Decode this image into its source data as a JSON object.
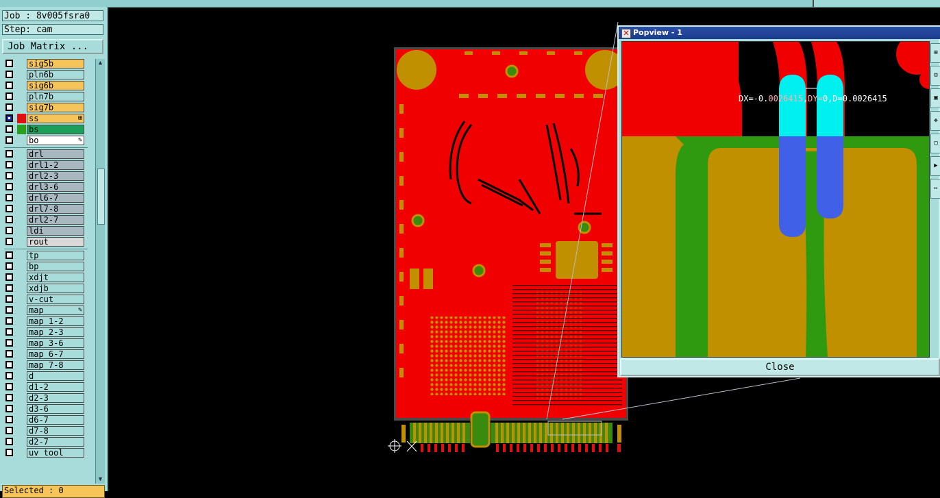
{
  "job": {
    "label": "Job : 8v005fsra0",
    "step": "Step: cam"
  },
  "buttons": {
    "job_matrix": "Job Matrix ...",
    "close": "Close"
  },
  "layers": [
    {
      "name": "sig5b",
      "color": "#f5c55a",
      "mark": ""
    },
    {
      "name": "pln6b",
      "color": "#a7dcda",
      "mark": ""
    },
    {
      "name": "sig6b",
      "color": "#f5c55a",
      "mark": ""
    },
    {
      "name": "pln7b",
      "color": "#a7dcda",
      "mark": ""
    },
    {
      "name": "sig7b",
      "color": "#f5c55a",
      "mark": ""
    },
    {
      "name": "ss",
      "color": "#f5c55a",
      "mark": "⊞",
      "checked": true,
      "swatch": "#e01010"
    },
    {
      "name": "bs",
      "color": "#1aa058",
      "mark": "",
      "swatch": "#2aa020"
    },
    {
      "name": "bo",
      "color": "#ffffff",
      "mark": "✎"
    },
    {
      "name": "drl",
      "color": "#a8b8c0",
      "mark": ""
    },
    {
      "name": "drl1-2",
      "color": "#a8b8c0",
      "mark": ""
    },
    {
      "name": "drl2-3",
      "color": "#a8b8c0",
      "mark": ""
    },
    {
      "name": "drl3-6",
      "color": "#a8b8c0",
      "mark": ""
    },
    {
      "name": "drl6-7",
      "color": "#a8b8c0",
      "mark": ""
    },
    {
      "name": "drl7-8",
      "color": "#a8b8c0",
      "mark": ""
    },
    {
      "name": "drl2-7",
      "color": "#a8b8c0",
      "mark": ""
    },
    {
      "name": "ldi",
      "color": "#a8b8c0",
      "mark": ""
    },
    {
      "name": "rout",
      "color": "#d8d8d8",
      "mark": ""
    },
    {
      "name": "tp",
      "color": "#a7dcda",
      "mark": ""
    },
    {
      "name": "bp",
      "color": "#a7dcda",
      "mark": ""
    },
    {
      "name": "xdjt",
      "color": "#a7dcda",
      "mark": ""
    },
    {
      "name": "xdjb",
      "color": "#a7dcda",
      "mark": ""
    },
    {
      "name": "v-cut",
      "color": "#a7dcda",
      "mark": ""
    },
    {
      "name": "map",
      "color": "#a7dcda",
      "mark": "✎"
    },
    {
      "name": "map_1-2",
      "color": "#a7dcda",
      "mark": ""
    },
    {
      "name": "map_2-3",
      "color": "#a7dcda",
      "mark": ""
    },
    {
      "name": "map_3-6",
      "color": "#a7dcda",
      "mark": ""
    },
    {
      "name": "map_6-7",
      "color": "#a7dcda",
      "mark": ""
    },
    {
      "name": "map_7-8",
      "color": "#a7dcda",
      "mark": ""
    },
    {
      "name": "d",
      "color": "#a7dcda",
      "mark": ""
    },
    {
      "name": "d1-2",
      "color": "#a7dcda",
      "mark": ""
    },
    {
      "name": "d2-3",
      "color": "#a7dcda",
      "mark": ""
    },
    {
      "name": "d3-6",
      "color": "#a7dcda",
      "mark": ""
    },
    {
      "name": "d6-7",
      "color": "#a7dcda",
      "mark": ""
    },
    {
      "name": "d7-8",
      "color": "#a7dcda",
      "mark": ""
    },
    {
      "name": "d2-7",
      "color": "#a7dcda",
      "mark": ""
    },
    {
      "name": "uv_tool",
      "color": "#a7dcda",
      "mark": ""
    }
  ],
  "status": {
    "selected": "Selected : 0"
  },
  "popview": {
    "title": "Popview - 1",
    "measure_dx": "DX=-0.",
    "measure_dx_hl": "0026415",
    "measure_sep": ",",
    "measure_dy": "DY=",
    "measure_rest": "0,D=0.0026415"
  },
  "colors": {
    "copper_red": "#f00000",
    "pad_gold": "#c09000",
    "board_green": "#2f9a10",
    "cyan": "#00f0f0",
    "blue": "#4060e8",
    "ui_teal": "#a7dcda"
  }
}
